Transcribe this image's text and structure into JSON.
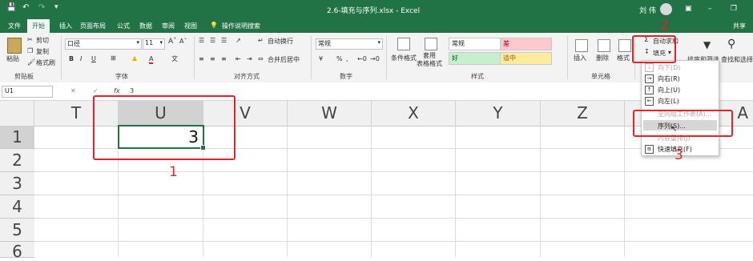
{
  "titlebar": {
    "doc_title": "2.6-填充与序列.xlsx - Excel",
    "user": "刘 伟"
  },
  "tabs": [
    "文件",
    "开始",
    "插入",
    "页面布局",
    "公式",
    "数据",
    "审阅",
    "视图"
  ],
  "tell_me": "操作说明搜索",
  "share_label": "共享",
  "ribbon": {
    "clipboard": {
      "paste": "粘贴",
      "cut": "剪切",
      "copy": "复制",
      "format_painter": "格式刷",
      "group": "剪贴板"
    },
    "font": {
      "name": "口径",
      "size": "11",
      "group": "字体"
    },
    "alignment": {
      "wrap": "自动换行",
      "merge": "合并后居中",
      "group": "对齐方式"
    },
    "number": {
      "format": "常规",
      "group": "数字"
    },
    "styles": {
      "conditional": "条件格式",
      "table": "套用\n表格格式",
      "normal": "常规",
      "bad": "差",
      "good": "好",
      "neutral": "适中",
      "group": "样式"
    },
    "cells": {
      "insert": "插入",
      "delete": "删除",
      "format": "格式",
      "group": "单元格"
    },
    "editing": {
      "autosum": "自动求和",
      "fill": "填充",
      "sort": "排序和筛选",
      "find": "查找和选择"
    }
  },
  "formula_bar": {
    "name_box": "U1",
    "fx": "fx",
    "value": "3"
  },
  "columns": [
    "T",
    "U",
    "V",
    "W",
    "X",
    "Y",
    "Z",
    "A"
  ],
  "rows": [
    "1",
    "2",
    "3",
    "4",
    "5",
    "6"
  ],
  "cell_U1": "3",
  "fill_menu": {
    "items": [
      {
        "label": "向下(D)",
        "disabled": true
      },
      {
        "label": "向右(R)",
        "disabled": false
      },
      {
        "label": "向上(U)",
        "disabled": false
      },
      {
        "label": "向左(L)",
        "disabled": false
      },
      {
        "label": "至同组工作表(A)...",
        "disabled": true
      },
      {
        "label": "序列(S)...",
        "disabled": false
      },
      {
        "label": "内容重排(J)",
        "disabled": true
      },
      {
        "label": "快速填充(F)",
        "disabled": false
      }
    ]
  },
  "annotations": {
    "one": "1",
    "two": "2",
    "three": "3"
  },
  "colors": {
    "excel_green": "#217346",
    "annotation_red": "#e3232a"
  }
}
